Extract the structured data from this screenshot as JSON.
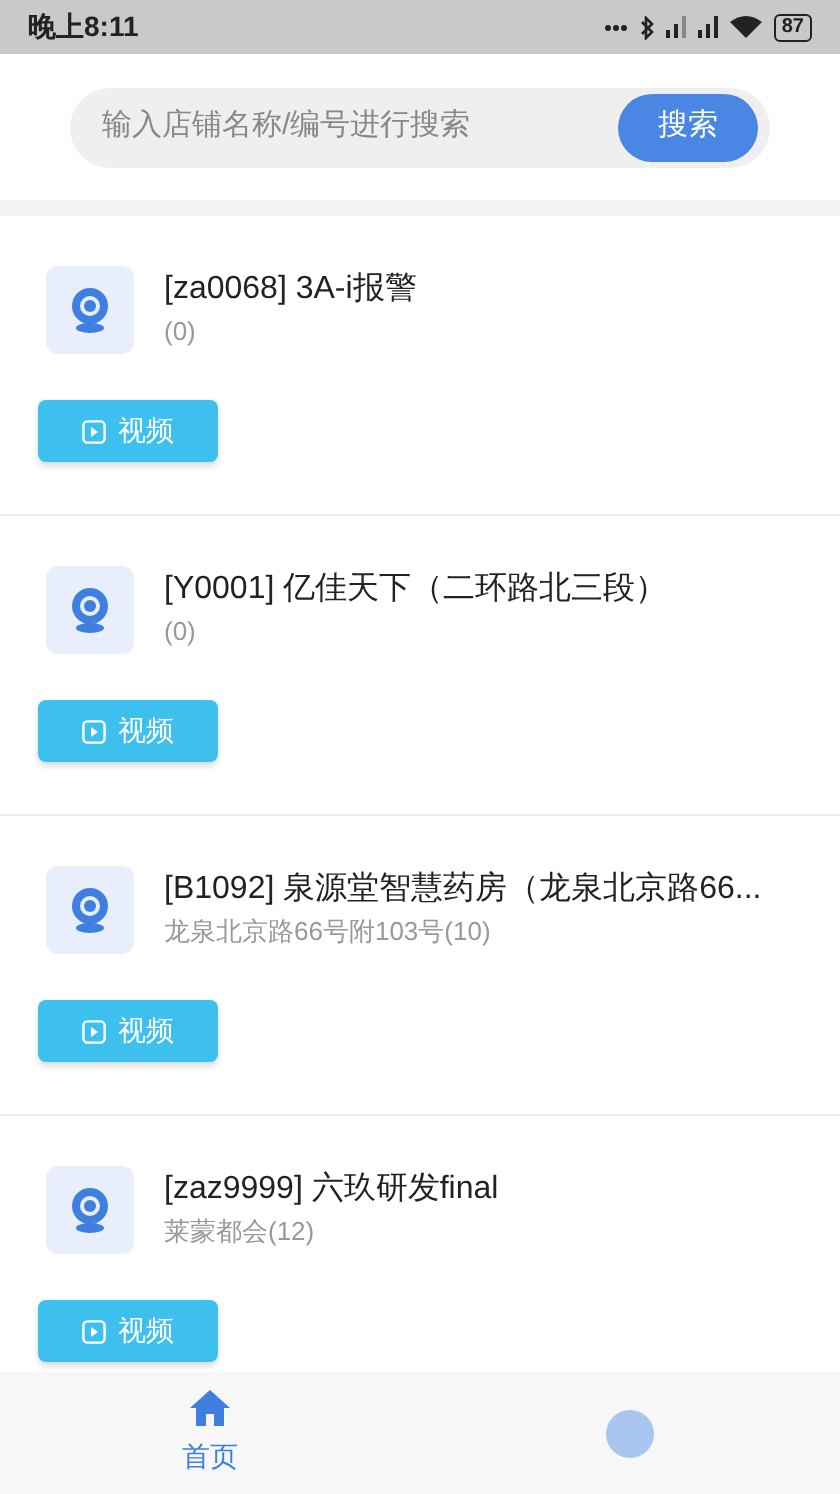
{
  "status_bar": {
    "time": "晚上8:11",
    "battery": "87"
  },
  "search": {
    "placeholder": "输入店铺名称/编号进行搜索",
    "button": "搜索"
  },
  "stores": [
    {
      "title": "[za0068] 3A-i报警",
      "subtitle": "(0)",
      "button": "视频"
    },
    {
      "title": "[Y0001] 亿佳天下（二环路北三段）",
      "subtitle": "(0)",
      "button": "视频"
    },
    {
      "title": "[B1092] 泉源堂智慧药房（龙泉北京路66...",
      "subtitle": "龙泉北京路66号附103号(10)",
      "button": "视频"
    },
    {
      "title": "[zaz9999] 六玖研发final",
      "subtitle": "莱蒙都会(12)",
      "button": "视频"
    }
  ],
  "tabs": [
    {
      "kind": "home",
      "label": "首页",
      "selected": true
    },
    {
      "kind": "person",
      "selected": false
    }
  ]
}
